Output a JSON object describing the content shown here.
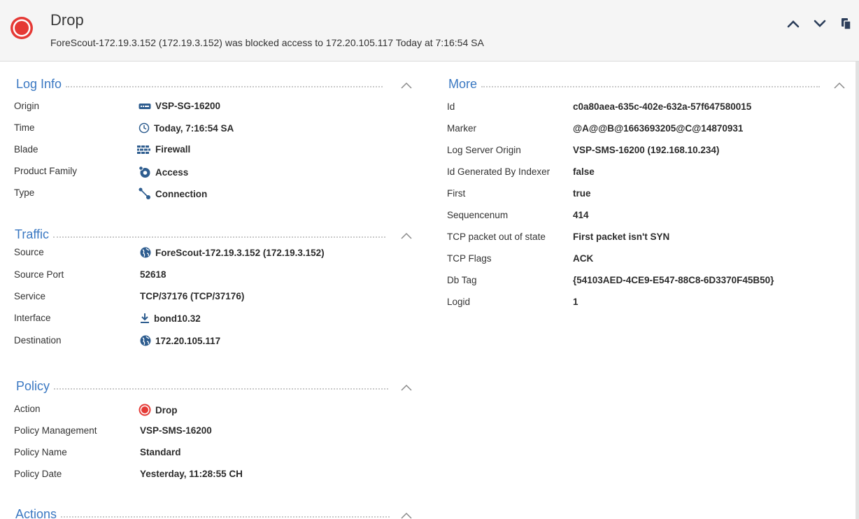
{
  "header": {
    "title": "Drop",
    "subtitle": "ForeScout-172.19.3.152 (172.19.3.152) was blocked access to 172.20.105.117 Today at  7:16:54 SA",
    "status_color": "#e53935"
  },
  "log_info": {
    "title": "Log Info",
    "rows": [
      {
        "key": "Origin",
        "value": "VSP-SG-16200",
        "icon": "gateway-icon"
      },
      {
        "key": "Time",
        "value": "Today, 7:16:54 SA",
        "icon": "clock-icon"
      },
      {
        "key": "Blade",
        "value": "Firewall",
        "icon": "firewall-icon"
      },
      {
        "key": "Product Family",
        "value": "Access",
        "icon": "access-icon"
      },
      {
        "key": "Type",
        "value": "Connection",
        "icon": "connection-icon"
      }
    ]
  },
  "traffic": {
    "title": "Traffic",
    "rows": [
      {
        "key": "Source",
        "value": "ForeScout-172.19.3.152 (172.19.3.152)",
        "icon": "globe-icon"
      },
      {
        "key": "Source Port",
        "value": "52618"
      },
      {
        "key": "Service",
        "value": "TCP/37176 (TCP/37176)"
      },
      {
        "key": "Interface",
        "value": "bond10.32",
        "icon": "download-arrow-icon"
      },
      {
        "key": "Destination",
        "value": "172.20.105.117",
        "icon": "globe-icon"
      }
    ]
  },
  "policy": {
    "title": "Policy",
    "rows": [
      {
        "key": "Action",
        "value": "Drop",
        "icon": "drop-icon"
      },
      {
        "key": "Policy Management",
        "value": "VSP-SMS-16200"
      },
      {
        "key": "Policy Name",
        "value": "Standard"
      },
      {
        "key": "Policy Date",
        "value": "Yesterday, 11:28:55 CH"
      }
    ]
  },
  "actions": {
    "title": "Actions"
  },
  "more": {
    "title": "More",
    "rows": [
      {
        "key": "Id",
        "value": "c0a80aea-635c-402e-632a-57f647580015"
      },
      {
        "key": "Marker",
        "value": "@A@@B@1663693205@C@14870931"
      },
      {
        "key": "Log Server Origin",
        "value": "VSP-SMS-16200 (192.168.10.234)"
      },
      {
        "key": "Id Generated By Indexer",
        "value": "false"
      },
      {
        "key": "First",
        "value": "true"
      },
      {
        "key": "Sequencenum",
        "value": "414"
      },
      {
        "key": "TCP packet out of state",
        "value": "First packet isn't SYN"
      },
      {
        "key": "TCP Flags",
        "value": "ACK"
      },
      {
        "key": "Db Tag",
        "value": "{54103AED-4CE9-E547-88C8-6D3370F45B50}"
      },
      {
        "key": "Logid",
        "value": "1"
      }
    ]
  }
}
